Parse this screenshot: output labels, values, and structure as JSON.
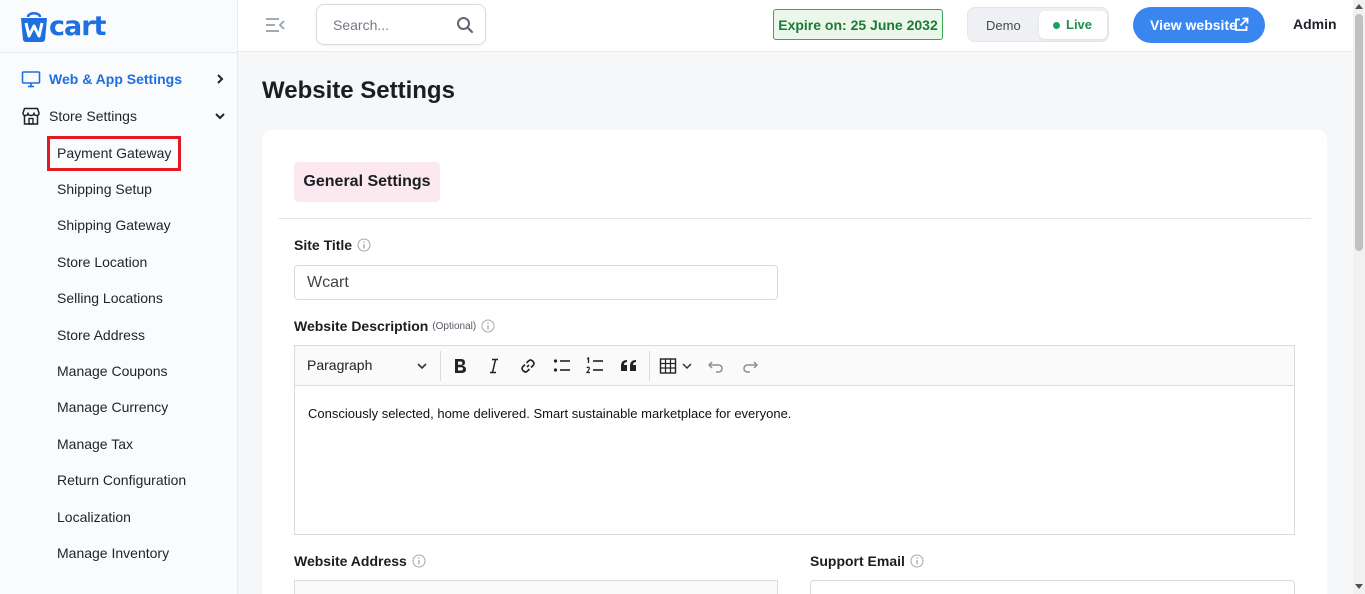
{
  "brand": {
    "name": "cart",
    "logo_letter": "W",
    "color": "#1e6fe0"
  },
  "sidebar": {
    "sections": [
      {
        "label": "Web & App Settings",
        "icon": "monitor-icon",
        "chevron": "chevron-right-icon",
        "active": true
      },
      {
        "label": "Store Settings",
        "icon": "store-icon",
        "chevron": "chevron-down-icon",
        "expanded": true
      }
    ],
    "store_items": [
      {
        "label": "Payment Gateway",
        "highlighted": true
      },
      {
        "label": "Shipping Setup"
      },
      {
        "label": "Shipping Gateway"
      },
      {
        "label": "Store Location"
      },
      {
        "label": "Selling Locations"
      },
      {
        "label": "Store Address"
      },
      {
        "label": "Manage Coupons"
      },
      {
        "label": "Manage Currency"
      },
      {
        "label": "Manage Tax"
      },
      {
        "label": "Return Configuration"
      },
      {
        "label": "Localization"
      },
      {
        "label": "Manage Inventory"
      }
    ]
  },
  "header": {
    "search_placeholder": "Search...",
    "expire_text": "Expire on: 25 June 2032",
    "mode": {
      "demo_label": "Demo",
      "live_label": "Live",
      "selected": "Live"
    },
    "view_website_label": "View website",
    "user_label": "Admin"
  },
  "main": {
    "page_title": "Website Settings",
    "section_tab": "General Settings",
    "site_title": {
      "label": "Site Title",
      "value": "Wcart"
    },
    "website_description": {
      "label": "Website Description",
      "optional_label": "(Optional)",
      "toolbar_block_style": "Paragraph",
      "toolbar_icons": [
        "bold-icon",
        "italic-icon",
        "link-icon",
        "bulleted-list-icon",
        "numbered-list-icon",
        "quote-icon",
        "table-icon",
        "undo-icon",
        "redo-icon"
      ],
      "content": "Consciously selected, home delivered. Smart sustainable marketplace for everyone."
    },
    "website_address": {
      "label": "Website Address"
    },
    "support_email": {
      "label": "Support Email"
    }
  },
  "colors": {
    "accent": "#3a86f1",
    "highlight_box": "#e01b24",
    "live_green": "#1aa35b",
    "tab_bg": "#fce8ef"
  }
}
